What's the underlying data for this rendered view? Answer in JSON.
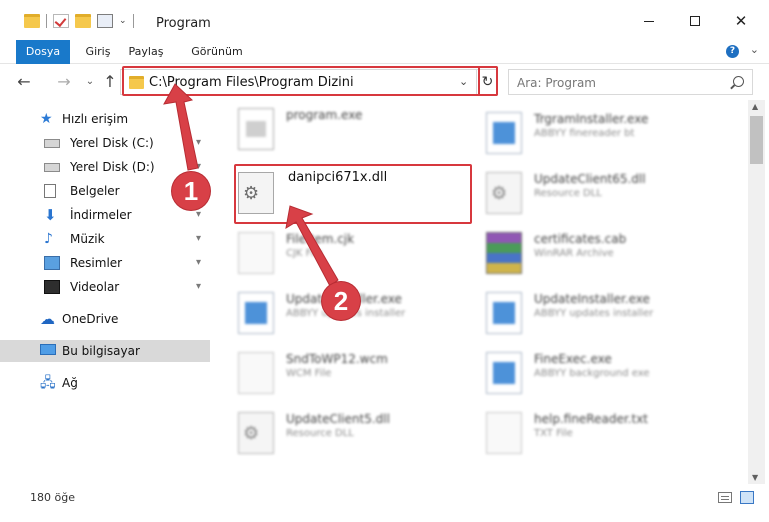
{
  "window": {
    "title": "Program",
    "min_glyph": "—",
    "close_glyph": "✕"
  },
  "ribbon": {
    "tabs": [
      "Dosya",
      "Giriş",
      "Paylaş",
      "Görünüm"
    ],
    "expand_glyph": "⌄",
    "help_glyph": "?"
  },
  "nav": {
    "back_glyph": "←",
    "forward_glyph": "→",
    "recent_glyph": "⌄",
    "up_glyph": "↑",
    "address": "C:\\Program Files\\Program Dizini",
    "address_dropdown_glyph": "⌄",
    "refresh_glyph": "↻",
    "search_placeholder": "Ara: Program"
  },
  "sidebar": {
    "quick_access": "Hızlı erişim",
    "items": [
      {
        "label": "Yerel Disk (C:)",
        "pinned": true
      },
      {
        "label": "Yerel Disk (D:)",
        "pinned": true
      },
      {
        "label": "Belgeler",
        "pinned": true
      },
      {
        "label": "İndirmeler",
        "pinned": true
      },
      {
        "label": "Müzik",
        "pinned": true
      },
      {
        "label": "Resimler",
        "pinned": true
      },
      {
        "label": "Videolar",
        "pinned": true
      }
    ],
    "onedrive": "OneDrive",
    "this_pc": "Bu bilgisayar",
    "network": "Ağ",
    "pin_glyph": "📌"
  },
  "files": {
    "target": {
      "name": "danipci671x.dll"
    },
    "left_column": [
      {
        "name": "program.exe",
        "type": ""
      },
      {
        "name": "FileItem.cjk",
        "type": "CJK File"
      },
      {
        "name": "UpdateInstaller.exe",
        "type": "ABBYY updates installer"
      },
      {
        "name": "SndToWP12.wcm",
        "type": "WCM File"
      },
      {
        "name": "UpdateClient5.dll",
        "type": "Resource DLL"
      }
    ],
    "right_column": [
      {
        "name": "TrgramInstaller.exe",
        "type": "ABBYY finereader bt"
      },
      {
        "name": "UpdateClient65.dll",
        "type": "Resource DLL"
      },
      {
        "name": "certificates.cab",
        "type": "WinRAR Archive"
      },
      {
        "name": "UpdateInstaller.exe",
        "type": "ABBYY updates installer"
      },
      {
        "name": "FineExec.exe",
        "type": "ABBYY background exe"
      },
      {
        "name": "help.fineReader.txt",
        "type": "TXT File"
      }
    ]
  },
  "status": {
    "count": "180 öğe"
  },
  "steps": {
    "one": "1",
    "two": "2"
  },
  "colors": {
    "accent": "#1979ca",
    "highlight": "#d7383e",
    "step_marker": "#d84047"
  }
}
